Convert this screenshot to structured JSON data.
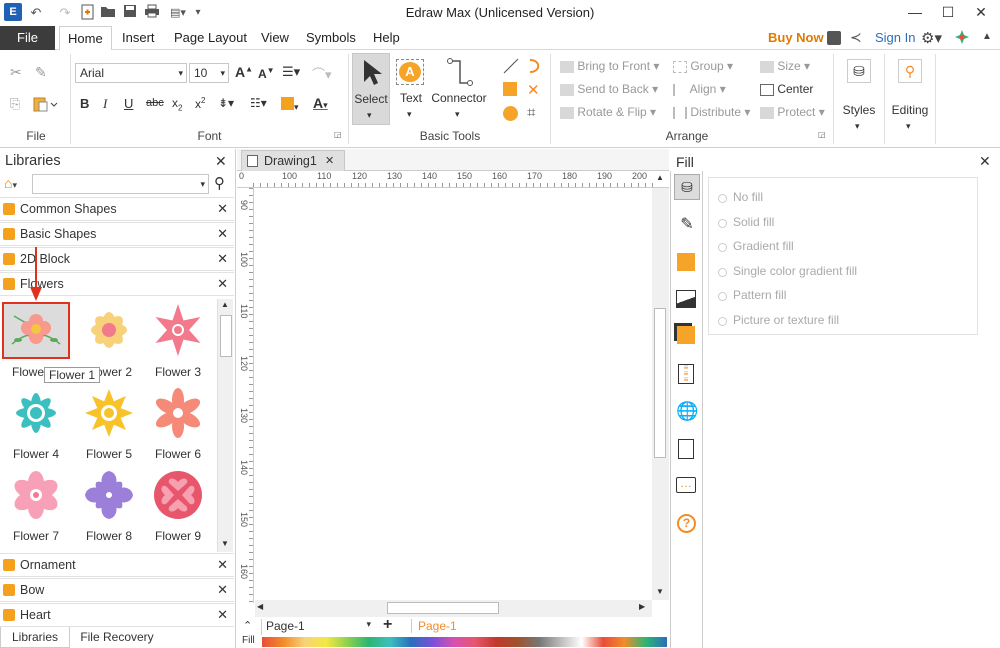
{
  "window": {
    "title": "Edraw Max (Unlicensed Version)"
  },
  "menus": {
    "file": "File",
    "home": "Home",
    "insert": "Insert",
    "page_layout": "Page Layout",
    "view": "View",
    "symbols": "Symbols",
    "help": "Help",
    "buy_now": "Buy Now",
    "sign_in": "Sign In"
  },
  "ribbon": {
    "font_name": "Arial",
    "font_size": "10",
    "groups": {
      "file": "File",
      "font": "Font",
      "basic_tools": "Basic Tools",
      "arrange": "Arrange"
    },
    "tools": {
      "select": "Select",
      "text": "Text",
      "connector": "Connector"
    },
    "arrange": {
      "bring_front": "Bring to Front",
      "send_back": "Send to Back",
      "rotate_flip": "Rotate & Flip",
      "group": "Group",
      "align": "Align",
      "distribute": "Distribute",
      "size": "Size",
      "center": "Center",
      "protect": "Protect"
    },
    "styles": "Styles",
    "editing": "Editing"
  },
  "libraries": {
    "title": "Libraries",
    "search_value": "",
    "sections": {
      "common": "Common Shapes",
      "basic": "Basic Shapes",
      "block2d": "2D Block",
      "flowers": "Flowers",
      "ornament": "Ornament",
      "bow": "Bow",
      "heart": "Heart"
    },
    "shapes": [
      "Flower 1",
      "Flower 2",
      "Flower 3",
      "Flower 4",
      "Flower 5",
      "Flower 6",
      "Flower 7",
      "Flower 8",
      "Flower 9"
    ],
    "tooltip": "Flower 1",
    "bottom_tabs": {
      "libraries": "Libraries",
      "recovery": "File Recovery"
    }
  },
  "document": {
    "tab": "Drawing1",
    "page_selector": "Page-1",
    "active_page": "Page-1",
    "fill_label": "Fill"
  },
  "ruler": {
    "h_ticks": [
      "0",
      "100",
      "110",
      "120",
      "130",
      "140",
      "150",
      "160",
      "170",
      "180",
      "190",
      "200"
    ],
    "v_ticks": [
      "90",
      "100",
      "110",
      "120",
      "130",
      "140",
      "150",
      "160"
    ]
  },
  "fill_panel": {
    "title": "Fill",
    "options": [
      "No fill",
      "Solid fill",
      "Gradient fill",
      "Single color gradient fill",
      "Pattern fill",
      "Picture or texture fill"
    ]
  },
  "colors": {
    "accent": "#f28c28",
    "highlight": "#e0311e",
    "orange_icon": "#f6a32a",
    "buy": "#e07a00",
    "signin": "#2a6ebb"
  }
}
